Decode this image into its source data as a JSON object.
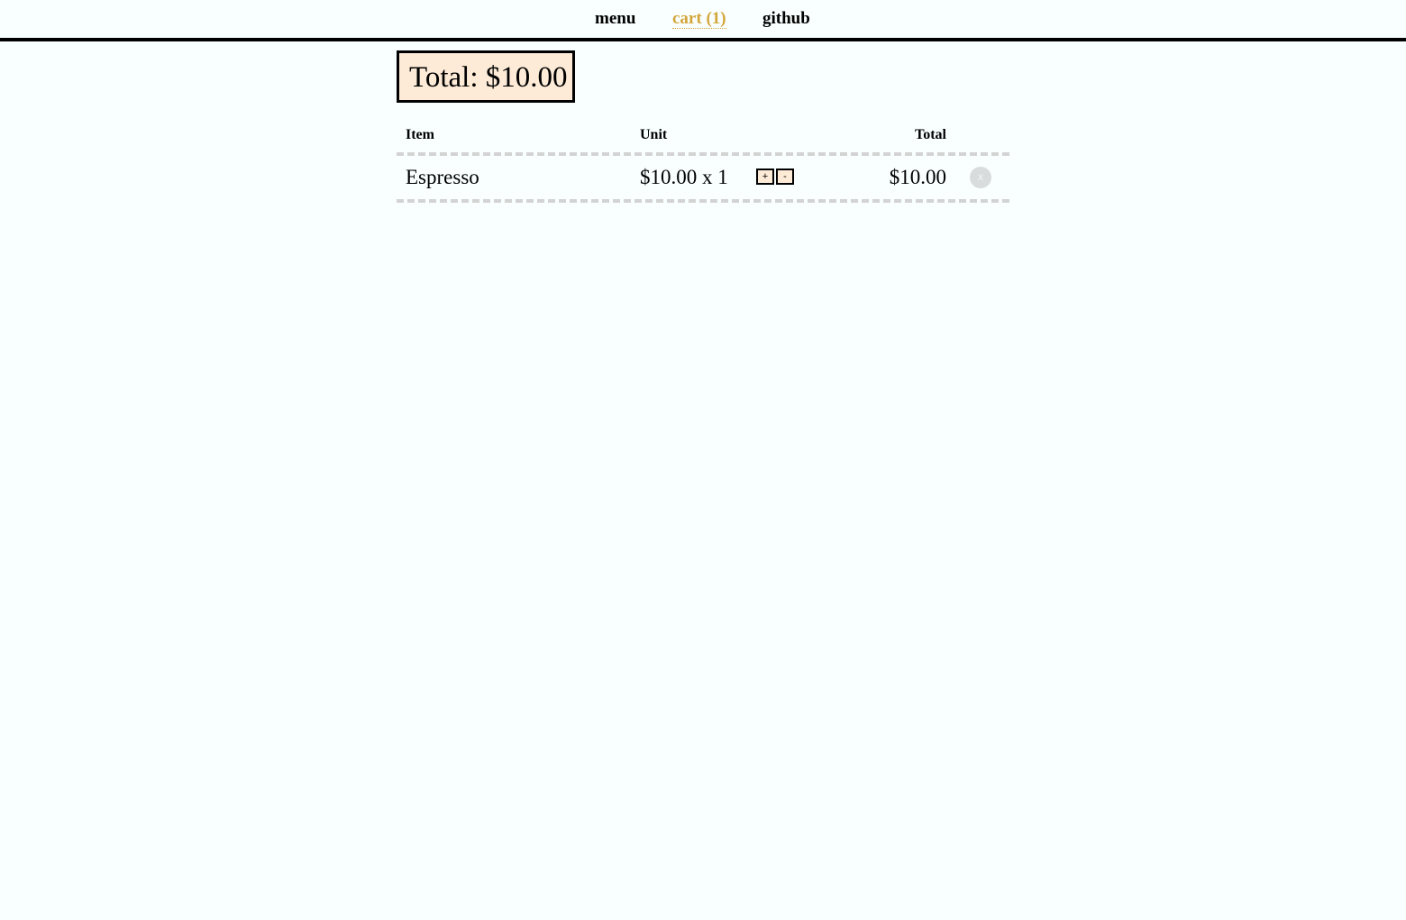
{
  "nav": {
    "menu_label": "menu",
    "cart_label": "cart (1)",
    "github_label": "github",
    "active_color": "#d4a63a"
  },
  "summary": {
    "total_label": "Total: $10.00"
  },
  "cart": {
    "headers": {
      "item": "Item",
      "unit": "Unit",
      "total": "Total"
    },
    "rows": [
      {
        "name": "Espresso",
        "unit": "$10.00 x 1",
        "increment_label": "+",
        "decrement_label": "-",
        "line_total": "$10.00",
        "remove_label": "x",
        "remove_icon": "close-icon"
      }
    ]
  },
  "colors": {
    "background": "#f8fffe",
    "total_box_fill": "#fdebd7",
    "divider": "#d3d3d3"
  }
}
